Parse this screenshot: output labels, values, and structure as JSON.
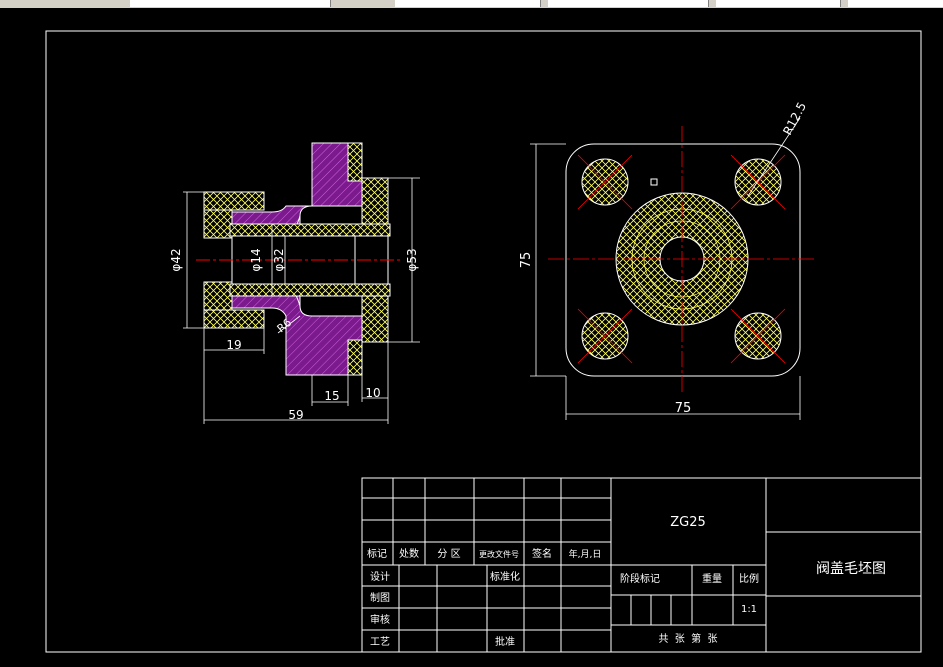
{
  "colors": {
    "background": "#000000",
    "outline": "#ffffff",
    "dimension": "#ffffff",
    "centerline": "#ff0000",
    "hatch_purple": "#7a1a8c",
    "hatch_yellow": "#ffff66",
    "toolbar": "#d4d0c8"
  },
  "section_view": {
    "dims": {
      "d42": "φ42",
      "d14": "φ14",
      "d32": "φ32",
      "d53": "φ53",
      "len19": "19",
      "len15": "15",
      "len10": "10",
      "len59": "59",
      "r6": "R6"
    }
  },
  "top_view": {
    "dims": {
      "height75": "75",
      "width75": "75",
      "r12_5": "R12.5"
    }
  },
  "title_block": {
    "material": "ZG25",
    "drawing_name": "阀盖毛坯图",
    "row_labels": {
      "mark": "标记",
      "count": "处数",
      "zone": "分 区",
      "change_doc": "更改文件号",
      "sign": "签名",
      "date": "年,月,日"
    },
    "design": "设计",
    "standardize": "标准化",
    "drawing": "制图",
    "review": "审核",
    "process": "工艺",
    "approve": "批准",
    "stage_mark": "阶段标记",
    "weight": "重量",
    "scale_label": "比例",
    "scale_value": "1:1",
    "sheets": "共  张  第  张"
  }
}
